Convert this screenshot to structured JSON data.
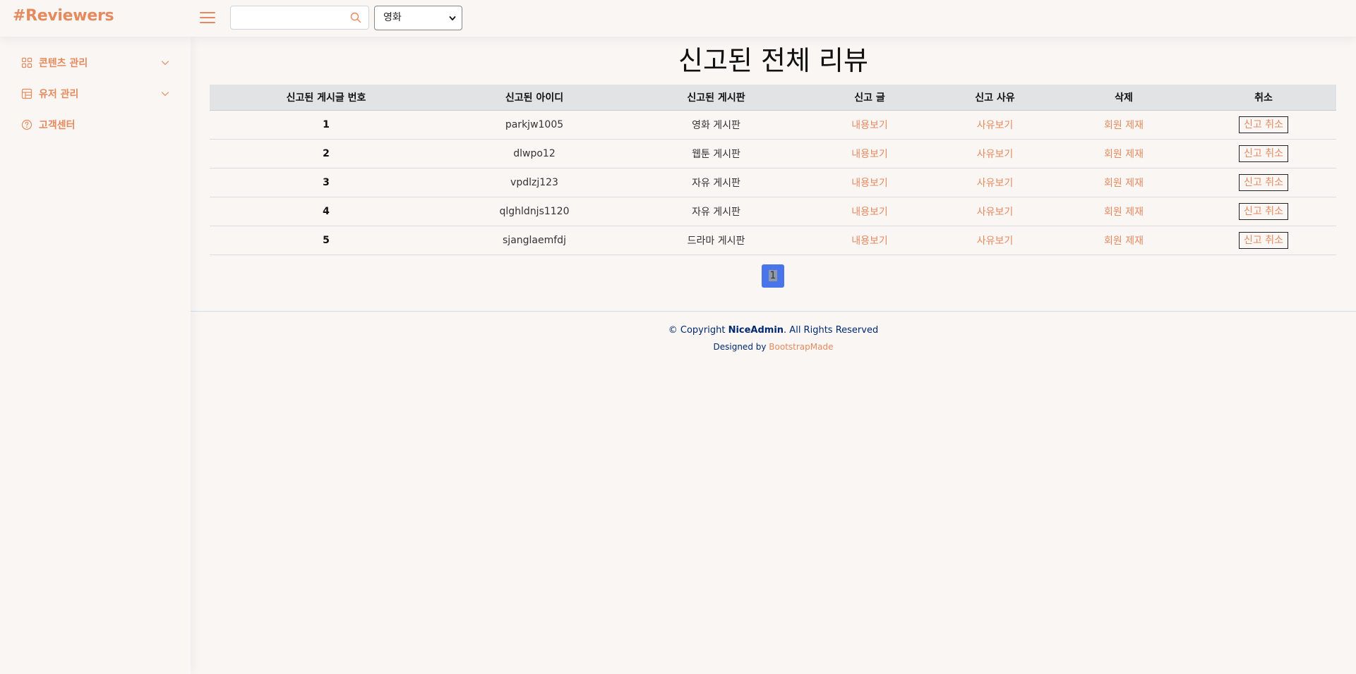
{
  "header": {
    "logo": "#Reviewers",
    "search": {
      "value": "",
      "placeholder": ""
    },
    "category_select": {
      "selected": "영화"
    }
  },
  "sidebar": {
    "items": [
      {
        "label": "콘텐츠 관리",
        "icon": "grid-icon",
        "has_chevron": true
      },
      {
        "label": "유저 관리",
        "icon": "layout-icon",
        "has_chevron": true
      },
      {
        "label": "고객센터",
        "icon": "question-circle-icon",
        "has_chevron": false
      }
    ]
  },
  "main": {
    "title": "신고된 전체 리뷰",
    "table": {
      "headers": [
        "신고된 게시글 번호",
        "신고된 아이디",
        "신고된 게시판",
        "신고 글",
        "신고 사유",
        "삭제",
        "취소"
      ],
      "rows": [
        {
          "num": "1",
          "user_id": "parkjw1005",
          "board": "영화 게시판",
          "content": "내용보기",
          "reason": "사유보기",
          "delete": "회원 제재",
          "cancel": "신고 취소"
        },
        {
          "num": "2",
          "user_id": "dlwpo12",
          "board": "웹툰 게시판",
          "content": "내용보기",
          "reason": "사유보기",
          "delete": "회원 제재",
          "cancel": "신고 취소"
        },
        {
          "num": "3",
          "user_id": "vpdlzj123",
          "board": "자유 게시판",
          "content": "내용보기",
          "reason": "사유보기",
          "delete": "회원 제재",
          "cancel": "신고 취소"
        },
        {
          "num": "4",
          "user_id": "qlghldnjs1120",
          "board": "자유 게시판",
          "content": "내용보기",
          "reason": "사유보기",
          "delete": "회원 제재",
          "cancel": "신고 취소"
        },
        {
          "num": "5",
          "user_id": "sjanglaemfdj",
          "board": "드라마 게시판",
          "content": "내용보기",
          "reason": "사유보기",
          "delete": "회원 제재",
          "cancel": "신고 취소"
        }
      ]
    },
    "pagination": {
      "current": "1"
    }
  },
  "footer": {
    "copyright_prefix": "© Copyright ",
    "copyright_brand": "NiceAdmin",
    "copyright_suffix": ". All Rights Reserved",
    "credits_prefix": "Designed by ",
    "credits_link": "BootstrapMade"
  },
  "colors": {
    "accent": "#e58a5f",
    "background": "#f9f6f3",
    "table_header": "#e2e3e5",
    "page_active": "#4a74ea",
    "footer_text": "#012970"
  }
}
